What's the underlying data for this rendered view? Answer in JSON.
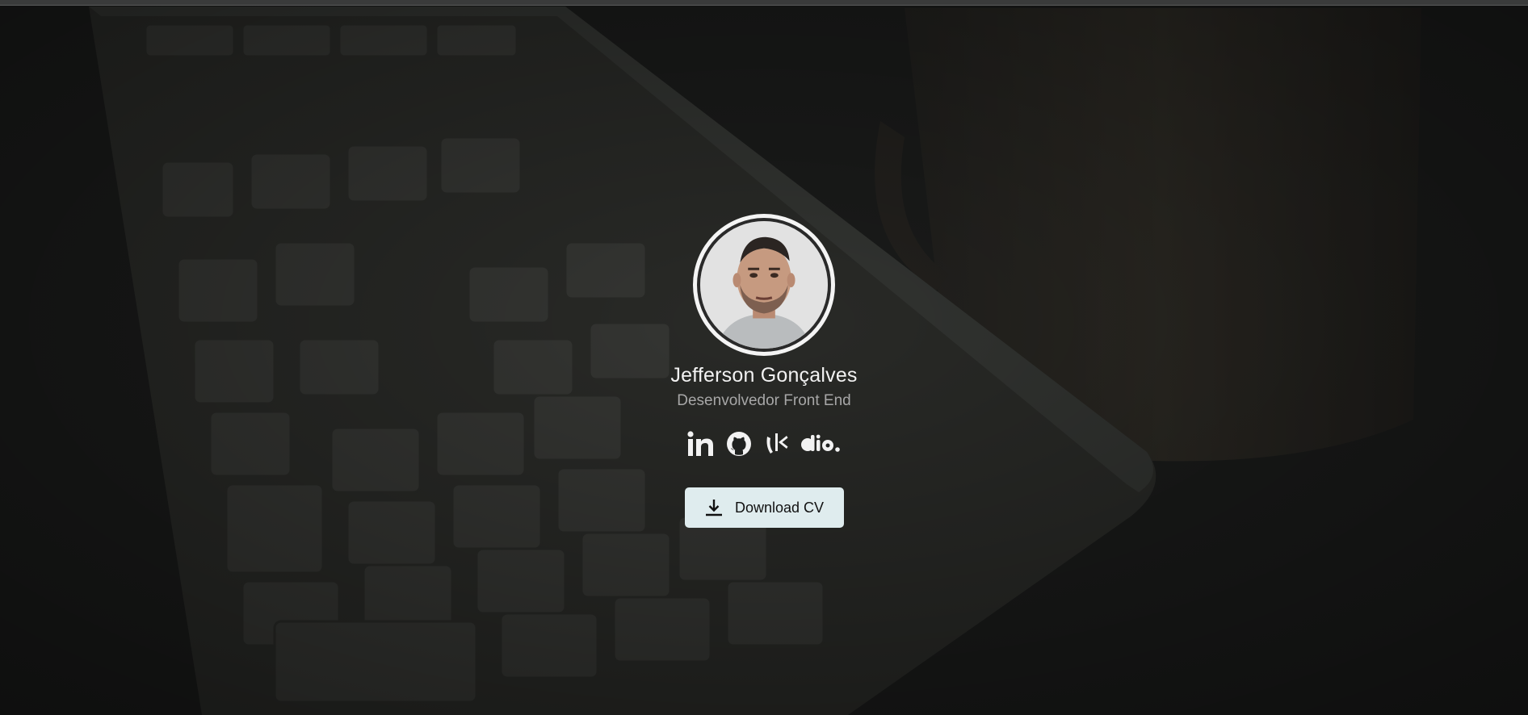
{
  "profile": {
    "name": "Jefferson Gonçalves",
    "role": "Desenvolvedor Front End"
  },
  "socials": [
    {
      "icon": "linkedin-icon"
    },
    {
      "icon": "github-icon"
    },
    {
      "icon": "rocketseat-icon"
    },
    {
      "icon": "dio-icon"
    }
  ],
  "cv_button": {
    "label": "Download CV",
    "icon": "download-icon"
  },
  "colors": {
    "background": "#1d1f1e",
    "name_text": "#f2f2f2",
    "role_text": "#a7a7a7",
    "button_bg": "#dfecee"
  }
}
